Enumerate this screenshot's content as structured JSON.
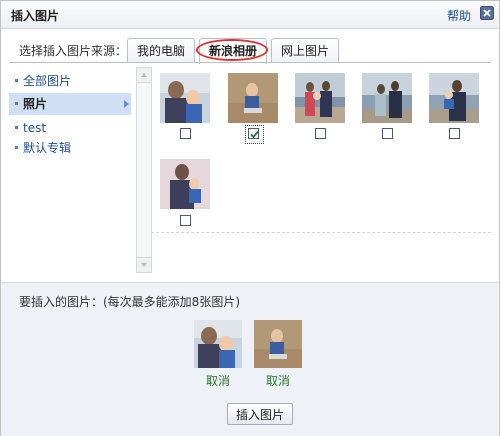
{
  "dialog": {
    "title": "插入图片",
    "help": "帮助"
  },
  "source": {
    "label": "选择插入图片来源：",
    "tabs": [
      {
        "label": "我的电脑"
      },
      {
        "label": "新浪相册"
      },
      {
        "label": "网上图片"
      }
    ],
    "active_tab": "新浪相册"
  },
  "sidebar": {
    "items": [
      {
        "label": "全部图片"
      },
      {
        "label": "照片"
      },
      {
        "label": "test"
      },
      {
        "label": "默认专辑"
      }
    ],
    "selected": "照片"
  },
  "photos": {
    "checked": [
      false,
      true,
      false,
      false,
      false,
      false
    ],
    "focused_index": 1
  },
  "selection": {
    "instruction": "要插入的图片：(每次最多能添加8张图片)",
    "cancel_label": "取消"
  },
  "actions": {
    "insert_label": "插入图片"
  },
  "colors": {
    "accent": "#1f4e8c",
    "tab_highlight": "#e03030",
    "sidebar_selected": "#cfe0f5",
    "cancel_link": "#2a7a2a"
  }
}
